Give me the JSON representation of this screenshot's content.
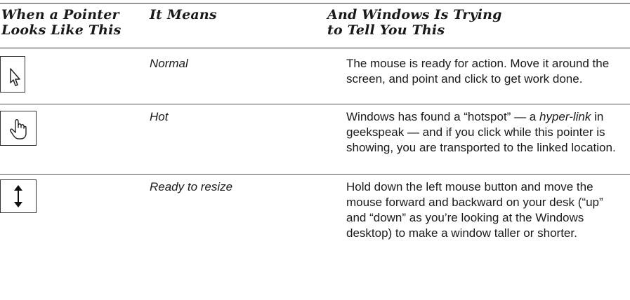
{
  "header": {
    "col1": [
      "When a Pointer",
      "Looks Like This"
    ],
    "col2": "It Means",
    "col3": [
      "And Windows Is Trying",
      "to Tell You This"
    ]
  },
  "rows": [
    {
      "icon": "arrow-pointer-icon",
      "meaning": "Normal",
      "description": "The mouse is ready for action. Move it around the screen, and point and click to get work done."
    },
    {
      "icon": "hand-pointer-icon",
      "meaning": "Hot",
      "description_parts": [
        "Windows has found a “hotspot” — a ",
        "hyper-link",
        " in geekspeak — and if you click while this pointer is showing, you are transported to the linked location."
      ]
    },
    {
      "icon": "vertical-resize-icon",
      "meaning": "Ready to resize",
      "description": "Hold down the left mouse button and move the mouse forward and backward on your desk (“up” and “down” as you’re looking at the Windows desktop) to make a window taller or shorter."
    }
  ]
}
